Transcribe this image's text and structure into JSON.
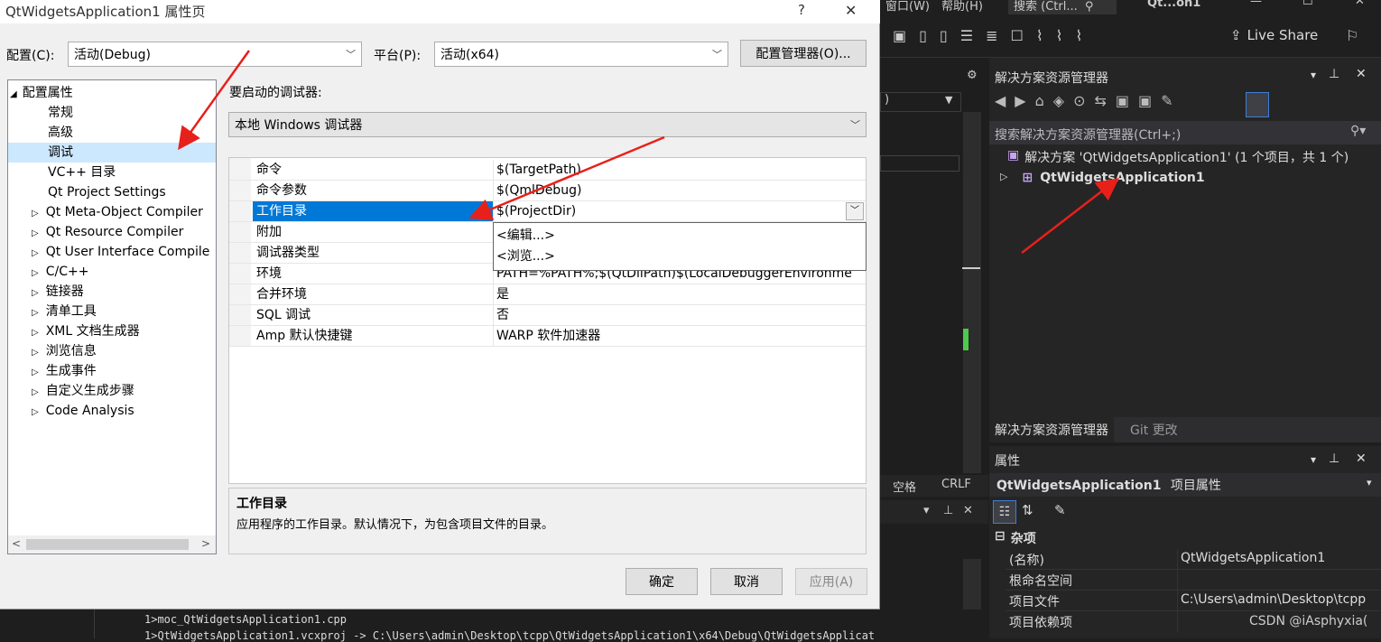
{
  "dialog": {
    "title": "QtWidgetsApplication1 属性页",
    "help": "?",
    "close": "✕",
    "config_label": "配置(C):",
    "config_value": "活动(Debug)",
    "platform_label": "平台(P):",
    "platform_value": "活动(x64)",
    "config_manager": "配置管理器(O)...",
    "debugger_label": "要启动的调试器:",
    "debugger_value": "本地 Windows 调试器",
    "tree": [
      {
        "label": "配置属性",
        "expanded": true
      },
      {
        "label": "常规"
      },
      {
        "label": "高级"
      },
      {
        "label": "调试",
        "selected": true
      },
      {
        "label": "VC++ 目录"
      },
      {
        "label": "Qt Project Settings"
      },
      {
        "label": "Qt Meta-Object Compiler"
      },
      {
        "label": "Qt Resource Compiler"
      },
      {
        "label": "Qt User Interface Compile"
      },
      {
        "label": "C/C++"
      },
      {
        "label": "链接器"
      },
      {
        "label": "清单工具"
      },
      {
        "label": "XML 文档生成器"
      },
      {
        "label": "浏览信息"
      },
      {
        "label": "生成事件"
      },
      {
        "label": "自定义生成步骤"
      },
      {
        "label": "Code Analysis"
      }
    ],
    "props": [
      {
        "key": "命令",
        "value": "$(TargetPath)"
      },
      {
        "key": "命令参数",
        "value": "$(QmlDebug)"
      },
      {
        "key": "工作目录",
        "value": "$(ProjectDir)"
      },
      {
        "key": "附加",
        "value": ""
      },
      {
        "key": "调试器类型",
        "value": ""
      },
      {
        "key": "环境",
        "value": "PATH=%PATH%;$(QtDllPath)$(LocalDebuggerEnvironme"
      },
      {
        "key": "合并环境",
        "value": "是"
      },
      {
        "key": "SQL 调试",
        "value": "否"
      },
      {
        "key": "Amp 默认快捷键",
        "value": "WARP 软件加速器"
      }
    ],
    "dropdown": [
      "<编辑...>",
      "<浏览...>"
    ],
    "desc_title": "工作目录",
    "desc_text": "应用程序的工作目录。默认情况下，为包含项目文件的目录。",
    "ok": "确定",
    "cancel": "取消",
    "apply": "应用(A)"
  },
  "vs": {
    "menu_window": "窗口(W)",
    "menu_help": "帮助(H)",
    "search": "搜索 (Ctrl...",
    "solution_name": "Qt...on1",
    "live_share": "Live Share",
    "spaces": "空格",
    "crlf": "CRLF",
    "output_lines": [
      "1>moc_QtWidgetsApplication1.cpp",
      "1>QtWidgetsApplication1.vcxproj -> C:\\Users\\admin\\Desktop\\tcpp\\QtWidgetsApplication1\\x64\\Debug\\QtWidgetsApplicat"
    ]
  },
  "solution_explorer": {
    "title": "解决方案资源管理器",
    "search_placeholder": "搜索解决方案资源管理器(Ctrl+;)",
    "solution_item": "解决方案 'QtWidgetsApplication1' (1 个项目，共 1 个)",
    "project_item": "QtWidgetsApplication1",
    "tab_solution": "解决方案资源管理器",
    "tab_git": "Git 更改"
  },
  "properties": {
    "title": "属性",
    "object_name": "QtWidgetsApplication1",
    "object_type": "项目属性",
    "category": "杂项",
    "rows": [
      {
        "key": "(名称)",
        "value": "QtWidgetsApplication1"
      },
      {
        "key": "根命名空间",
        "value": ""
      },
      {
        "key": "项目文件",
        "value": "C:\\Users\\admin\\Desktop\\tcpp"
      },
      {
        "key": "项目依赖项",
        "value": ""
      }
    ],
    "watermark": "CSDN @iAsphyxia("
  },
  "colors": {
    "selection": "#0078d7",
    "annotation_arrow": "#e8201a",
    "vs_dark": "#252526"
  }
}
